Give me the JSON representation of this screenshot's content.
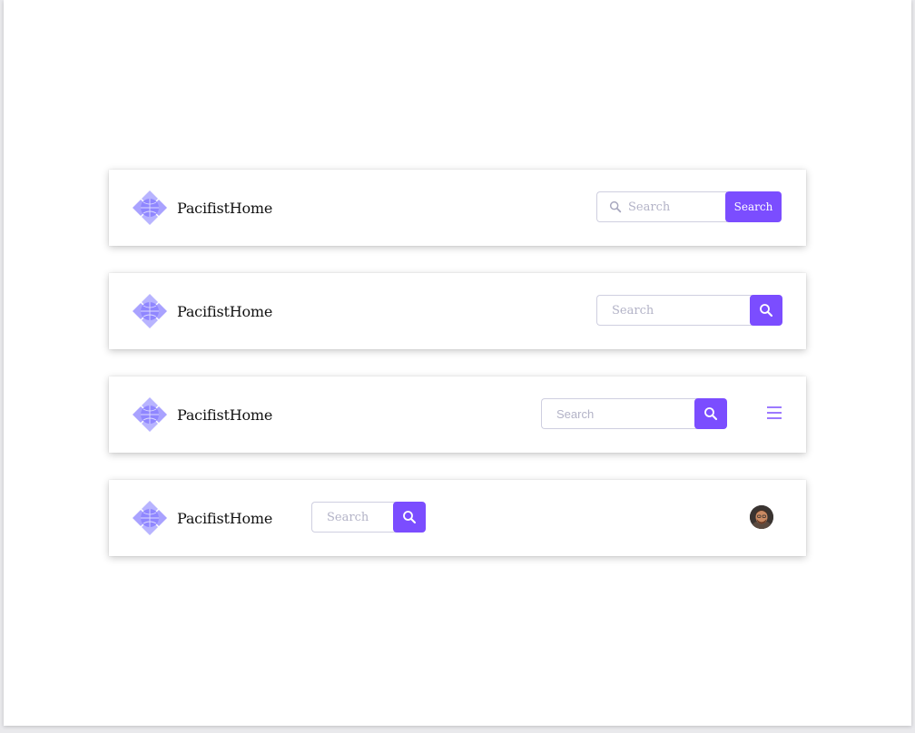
{
  "brand": {
    "name": "PacifistHome",
    "logo_icon": "lotus-globe-logo-icon"
  },
  "colors": {
    "accent": "#7b4dff",
    "logo_light": "#b8b4ff",
    "logo_mid": "#8f86ff",
    "placeholder": "#b3b3c7"
  },
  "navbars": [
    {
      "search_placeholder": "Search",
      "search_button_label": "Search",
      "input_icon": "search-icon"
    },
    {
      "search_placeholder": "Search",
      "search_button_icon": "search-icon"
    },
    {
      "search_placeholder": "Search",
      "search_button_icon": "search-icon",
      "menu_icon": "hamburger-menu-icon"
    },
    {
      "search_placeholder": "Search",
      "search_button_icon": "search-icon",
      "avatar": "user-avatar"
    }
  ]
}
